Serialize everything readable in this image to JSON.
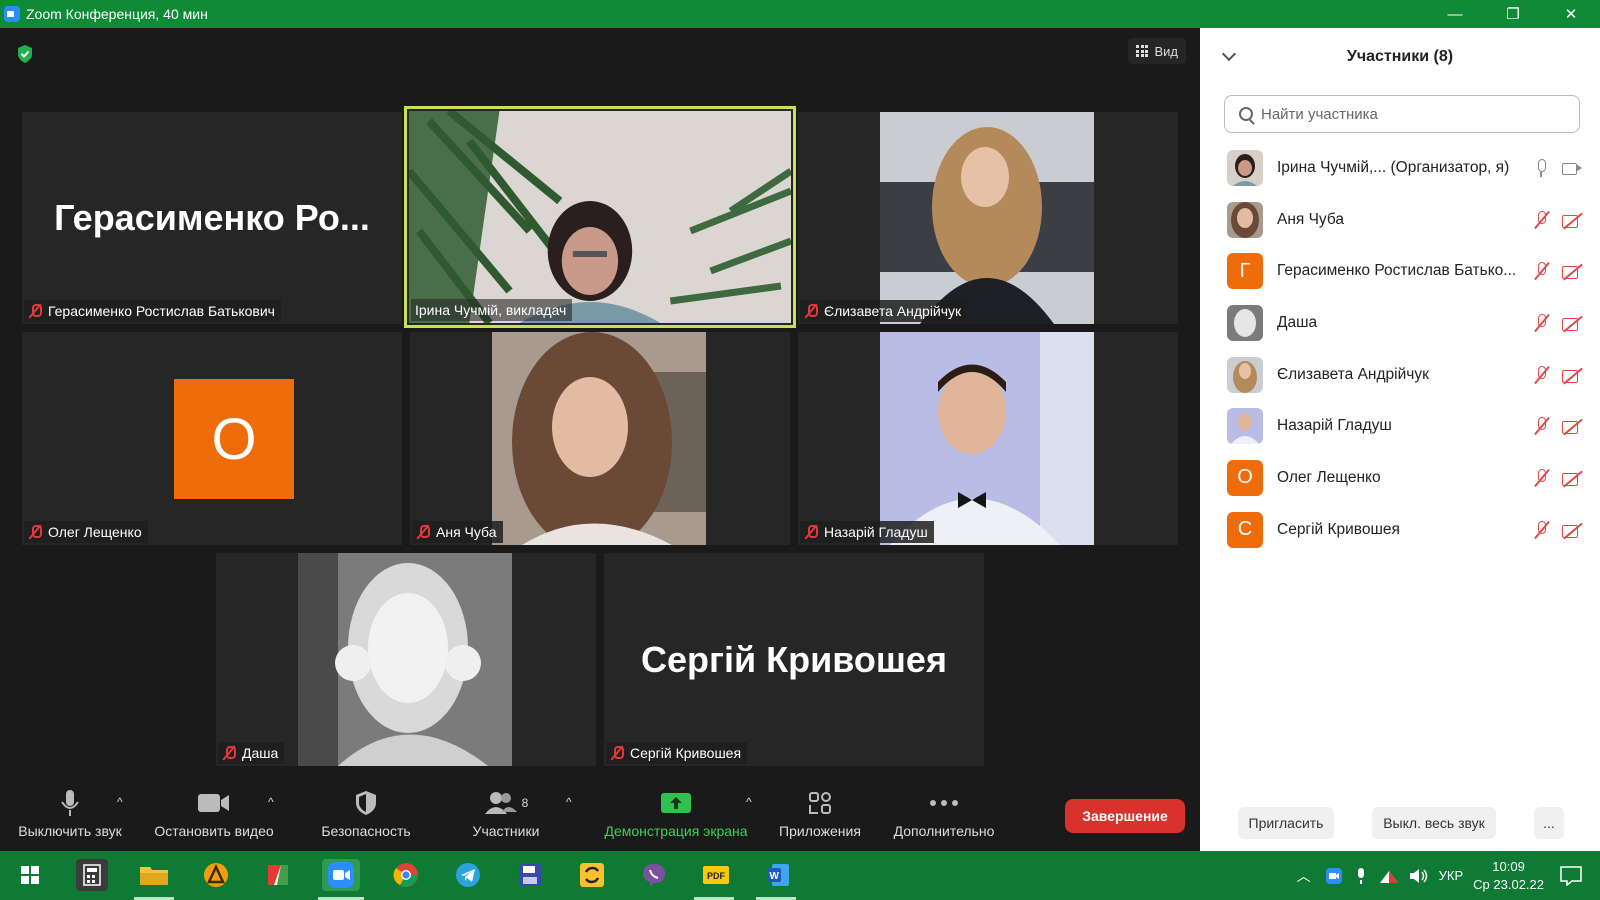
{
  "window": {
    "title": "Zoom Конференция, 40 мин",
    "controls": [
      "—",
      "❐",
      "✕"
    ]
  },
  "meeting": {
    "view_label": "Вид",
    "tiles": [
      {
        "id": "t1",
        "name": "Герасименко Ростислав Батькович",
        "big_name": "Герасименко  Ро...",
        "type": "name",
        "muted": true
      },
      {
        "id": "t2",
        "name": "Ірина Чучмій, викладач",
        "type": "video",
        "muted": false,
        "active": true
      },
      {
        "id": "t3",
        "name": "Єлизавета Андрійчук",
        "type": "video",
        "muted": true
      },
      {
        "id": "t4",
        "name": "Олег Лещенко",
        "type": "avatar",
        "avatar_letter": "О",
        "muted": true
      },
      {
        "id": "t5",
        "name": "Аня Чуба",
        "type": "video",
        "muted": true
      },
      {
        "id": "t6",
        "name": "Назарій Гладуш",
        "type": "video",
        "muted": true
      },
      {
        "id": "t7",
        "name": "Даша",
        "type": "video",
        "muted": true
      },
      {
        "id": "t8",
        "name": "Сергій Кривошея",
        "big_name": "Сергій Кривошея",
        "type": "name",
        "muted": true
      }
    ]
  },
  "toolbar": {
    "mute_label": "Выключить звук",
    "video_label": "Остановить видео",
    "security_label": "Безопасность",
    "participants_label": "Участники",
    "participants_count": "8",
    "share_label": "Демонстрация экрана",
    "apps_label": "Приложения",
    "more_label": "Дополнительно",
    "end_label": "Завершение"
  },
  "panel": {
    "title": "Участники (8)",
    "search_placeholder": "Найти участника",
    "participants": [
      {
        "name": "Ірина Чучмій,...  (Организатор, я)",
        "avatar": "photo",
        "mic_muted": false,
        "cam_off": false
      },
      {
        "name": "Аня Чуба",
        "avatar": "photo",
        "mic_muted": true,
        "cam_off": true
      },
      {
        "name": "Герасименко Ростислав Батько...",
        "avatar": "letter",
        "letter": "Г",
        "mic_muted": true,
        "cam_off": true
      },
      {
        "name": "Даша",
        "avatar": "photo",
        "mic_muted": true,
        "cam_off": true
      },
      {
        "name": "Єлизавета Андрійчук",
        "avatar": "photo",
        "mic_muted": true,
        "cam_off": true
      },
      {
        "name": "Назарій Гладуш",
        "avatar": "photo",
        "mic_muted": true,
        "cam_off": true
      },
      {
        "name": "Олег Лещенко",
        "avatar": "letter",
        "letter": "О",
        "mic_muted": true,
        "cam_off": true
      },
      {
        "name": "Сергій Кривошея",
        "avatar": "letter",
        "letter": "С",
        "mic_muted": true,
        "cam_off": true
      }
    ],
    "invite_label": "Пригласить",
    "mute_all_label": "Выкл. весь звук",
    "more_label": "..."
  },
  "taskbar": {
    "language": "УКР",
    "time": "10:09",
    "date": "Ср 23.02.22"
  },
  "colors": {
    "titlebar": "#0f8a37",
    "taskbar": "#0f7a33",
    "active_speaker": "#c8e05a",
    "end_button": "#d9312b",
    "avatar_orange": "#ee6d0a",
    "muted_red": "#e03a3a"
  }
}
